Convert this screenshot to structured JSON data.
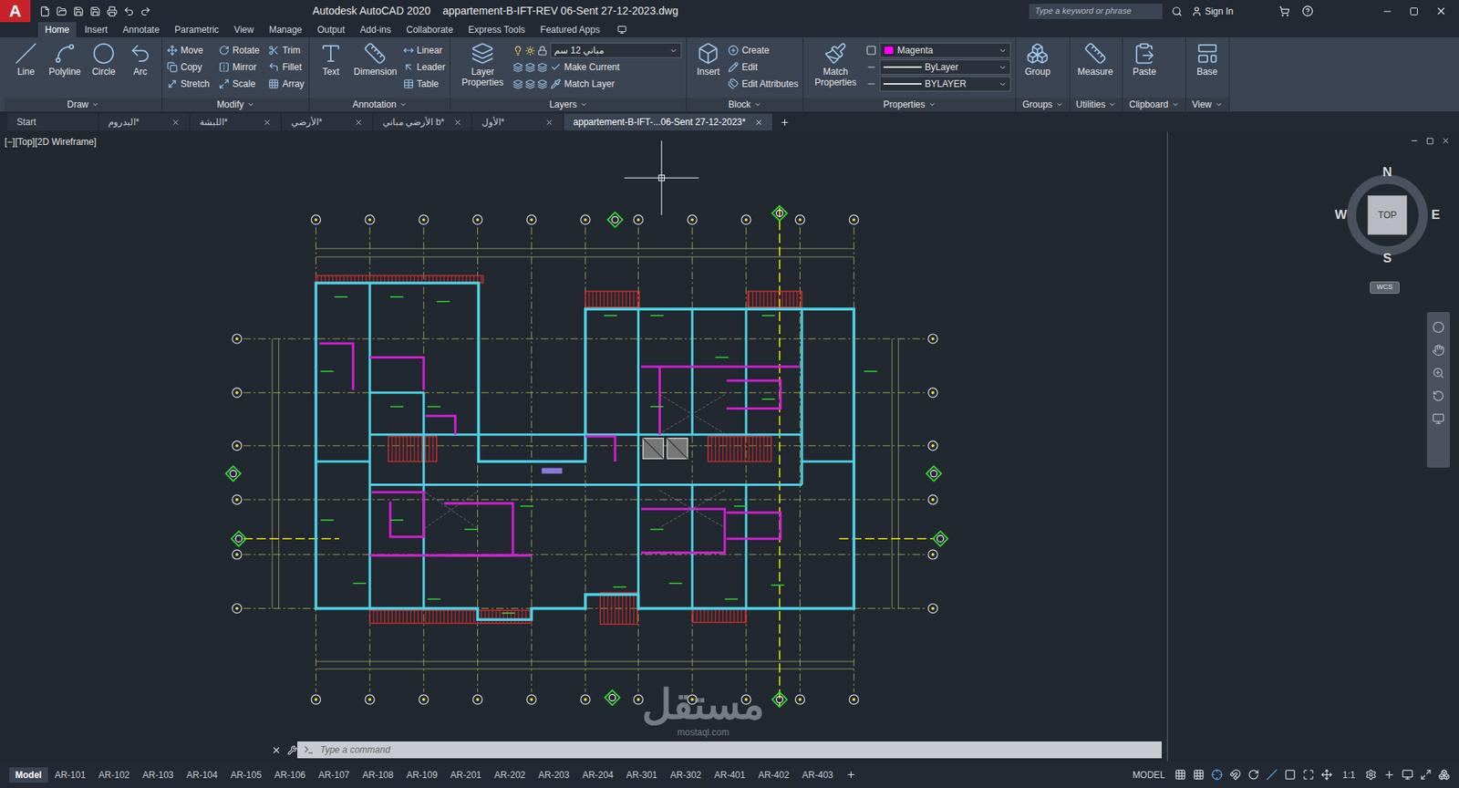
{
  "window": {
    "title": "Autodesk AutoCAD 2020",
    "document": "appartement-B-IFT-REV 06-Sent 27-12-2023.dwg"
  },
  "app_logo": "A",
  "search": {
    "placeholder": "Type a keyword or phrase"
  },
  "account": "Sign In",
  "ribbon_tabs": [
    {
      "label": "Home",
      "selected": true
    },
    {
      "label": "Insert",
      "selected": false
    },
    {
      "label": "Annotate",
      "selected": false
    },
    {
      "label": "Parametric",
      "selected": false
    },
    {
      "label": "View",
      "selected": false
    },
    {
      "label": "Manage",
      "selected": false
    },
    {
      "label": "Output",
      "selected": false
    },
    {
      "label": "Add-ins",
      "selected": false
    },
    {
      "label": "Collaborate",
      "selected": false
    },
    {
      "label": "Express Tools",
      "selected": false
    },
    {
      "label": "Featured Apps",
      "selected": false
    }
  ],
  "panels": [
    {
      "title": "Draw",
      "tools": [
        {
          "label": "Line",
          "kind": "large"
        },
        {
          "label": "Polyline",
          "kind": "large"
        },
        {
          "label": "Circle",
          "kind": "large"
        },
        {
          "label": "Arc",
          "kind": "large"
        }
      ]
    },
    {
      "title": "Modify",
      "tools": [
        {
          "label": "Move",
          "kind": "small"
        },
        {
          "label": "Copy",
          "kind": "small"
        },
        {
          "label": "Stretch",
          "kind": "small"
        },
        {
          "label": "Rotate",
          "kind": "small"
        },
        {
          "label": "Mirror",
          "kind": "small"
        },
        {
          "label": "Scale",
          "kind": "small"
        },
        {
          "label": "Trim",
          "kind": "small"
        },
        {
          "label": "Fillet",
          "kind": "small"
        },
        {
          "label": "Array",
          "kind": "small"
        }
      ]
    },
    {
      "title": "Annotation",
      "tools": [
        {
          "label": "Text",
          "kind": "large"
        },
        {
          "label": "Dimension",
          "kind": "large"
        },
        {
          "label": "Linear",
          "kind": "small"
        },
        {
          "label": "Leader",
          "kind": "small"
        },
        {
          "label": "Table",
          "kind": "small"
        }
      ]
    },
    {
      "title": "Layers",
      "tools": [
        {
          "label": "Layer Properties",
          "kind": "large"
        },
        {
          "label": "مباني 12 سم",
          "kind": "dropdown"
        },
        {
          "label": "Make Current",
          "kind": "small"
        },
        {
          "label": "Match Layer",
          "kind": "small"
        }
      ]
    },
    {
      "title": "Block",
      "tools": [
        {
          "label": "Insert",
          "kind": "large"
        },
        {
          "label": "Create",
          "kind": "small"
        },
        {
          "label": "Edit",
          "kind": "small"
        },
        {
          "label": "Edit Attributes",
          "kind": "small"
        }
      ]
    },
    {
      "title": "Properties",
      "tools": [
        {
          "label": "Match Properties",
          "kind": "large"
        },
        {
          "label": "Magenta",
          "kind": "dropdown",
          "color": "#ff00ff"
        },
        {
          "label": "ByLayer",
          "kind": "dropdown"
        },
        {
          "label": "BYLAYER",
          "kind": "dropdown"
        }
      ]
    },
    {
      "title": "Groups",
      "tools": [
        {
          "label": "Group",
          "kind": "large"
        }
      ]
    },
    {
      "title": "Utilities",
      "tools": [
        {
          "label": "Measure",
          "kind": "large"
        }
      ]
    },
    {
      "title": "Clipboard",
      "tools": [
        {
          "label": "Paste",
          "kind": "large"
        }
      ]
    },
    {
      "title": "View",
      "tools": [
        {
          "label": "Base",
          "kind": "large"
        }
      ]
    }
  ],
  "file_tabs": [
    {
      "label": "Start",
      "selected": false,
      "closable": false
    },
    {
      "label": "البدروم*",
      "selected": false,
      "closable": true
    },
    {
      "label": "اللبشة*",
      "selected": false,
      "closable": true
    },
    {
      "label": "الأرضي*",
      "selected": false,
      "closable": true
    },
    {
      "label": "الأرضي مباني b*",
      "selected": false,
      "closable": true
    },
    {
      "label": "الأول*",
      "selected": false,
      "closable": true
    },
    {
      "label": "appartement-B-IFT-...06-Sent 27-12-2023*",
      "selected": true,
      "closable": true
    }
  ],
  "viewport": {
    "label": "[−][Top][2D Wireframe]"
  },
  "viewcube": {
    "north": "N",
    "south": "S",
    "east": "E",
    "west": "W",
    "face": "TOP",
    "ucs": "WCS"
  },
  "command": {
    "placeholder": "Type a command"
  },
  "watermark": {
    "text": "مستقل",
    "subtext": "mostaql.com"
  },
  "layout_tabs": [
    {
      "label": "Model",
      "selected": true
    },
    {
      "label": "AR-101",
      "selected": false
    },
    {
      "label": "AR-102",
      "selected": false
    },
    {
      "label": "AR-103",
      "selected": false
    },
    {
      "label": "AR-104",
      "selected": false
    },
    {
      "label": "AR-105",
      "selected": false
    },
    {
      "label": "AR-106",
      "selected": false
    },
    {
      "label": "AR-107",
      "selected": false
    },
    {
      "label": "AR-108",
      "selected": false
    },
    {
      "label": "AR-109",
      "selected": false
    },
    {
      "label": "AR-201",
      "selected": false
    },
    {
      "label": "AR-202",
      "selected": false
    },
    {
      "label": "AR-203",
      "selected": false
    },
    {
      "label": "AR-204",
      "selected": false
    },
    {
      "label": "AR-301",
      "selected": false
    },
    {
      "label": "AR-302",
      "selected": false
    },
    {
      "label": "AR-401",
      "selected": false
    },
    {
      "label": "AR-402",
      "selected": false
    },
    {
      "label": "AR-403",
      "selected": false
    }
  ],
  "status_bar": {
    "mode": "MODEL",
    "scale": "1:1"
  }
}
